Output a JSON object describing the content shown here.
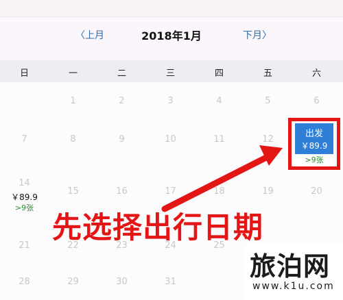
{
  "top_bar": {
    "fragment": "—— ———"
  },
  "header": {
    "prev_label": "〈上月",
    "month": "2018年1月",
    "next_label": "下月〉"
  },
  "weekdays": [
    "日",
    "一",
    "二",
    "三",
    "四",
    "五",
    "六"
  ],
  "days": {
    "d1": "1",
    "d2": "2",
    "d3": "3",
    "d4": "4",
    "d5": "5",
    "d6": "6",
    "d7": "7",
    "d8": "8",
    "d9": "9",
    "d10": "10",
    "d11": "11",
    "d12": "12",
    "d15": "15",
    "d16": "16",
    "d17": "17",
    "d18": "18",
    "d19": "19",
    "d20": "20",
    "d21": "21",
    "d22": "22",
    "d23": "23",
    "d24": "24",
    "d25": "25",
    "d28": "28",
    "d29": "29",
    "d30": "30",
    "d31": "31"
  },
  "day14": {
    "num": "14",
    "price": "￥89.9",
    "tickets": ">9张"
  },
  "depart": {
    "num": "13",
    "label": "出发",
    "price": "￥89.9",
    "tickets": ">9张"
  },
  "annotation": {
    "text": "先选择出行日期"
  },
  "watermark": {
    "logo": "旅泊网",
    "url": "www.k1u.com"
  },
  "colors": {
    "accent_blue": "#2f7fd9",
    "annotation_red": "#e31515",
    "ticket_green": "#2a8b2a",
    "nav_blue": "#2e6aa8"
  }
}
